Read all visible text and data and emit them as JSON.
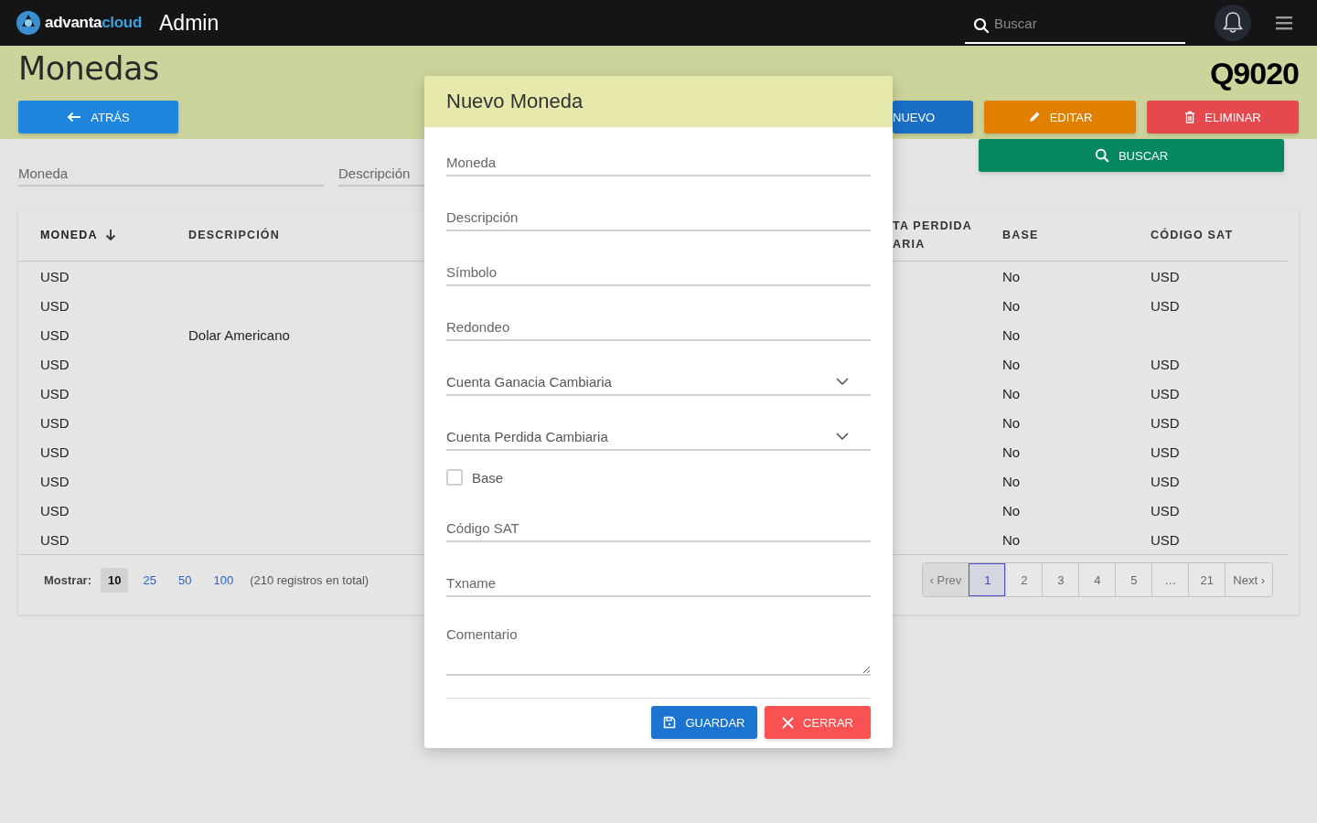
{
  "topbar": {
    "brand": {
      "part_1": "advanta",
      "part_2": "cloud"
    },
    "app_name": "Admin",
    "search": {
      "placeholder": "Buscar"
    }
  },
  "page": {
    "title": "Monedas",
    "code": "Q9020"
  },
  "actions": [
    {
      "label": "ATRÁS",
      "kind": "back"
    },
    {
      "label": "NUEVO",
      "kind": "new"
    },
    {
      "label": "EDITAR",
      "kind": "edit"
    },
    {
      "label": "ELIMINAR",
      "kind": "delete"
    }
  ],
  "search_button": {
    "label": "BUSCAR"
  },
  "filters": [
    {
      "placeholder": "Moneda"
    },
    {
      "placeholder": "Descripción"
    }
  ],
  "table": {
    "columns": [
      {
        "label": "MONEDA",
        "sorted": true
      },
      {
        "label": "DESCRIPCIÓN",
        "sorted": false
      },
      {
        "label": "TA PERDIDA ARIA",
        "sorted": false
      },
      {
        "label": "BASE",
        "sorted": false
      },
      {
        "label": "CÓDIGO SAT",
        "sorted": false
      }
    ],
    "rows": [
      {
        "moneda": "USD",
        "base": "No",
        "codigo_sat": "USD"
      },
      {
        "moneda": "USD",
        "base": "No",
        "codigo_sat": "USD"
      },
      {
        "moneda": "USD",
        "descripcion": "Dolar Americano",
        "base": "No"
      },
      {
        "moneda": "USD",
        "base": "No",
        "codigo_sat": "USD"
      },
      {
        "moneda": "USD",
        "base": "No",
        "codigo_sat": "USD"
      },
      {
        "moneda": "USD",
        "base": "No",
        "codigo_sat": "USD"
      },
      {
        "moneda": "USD",
        "base": "No",
        "codigo_sat": "USD"
      },
      {
        "moneda": "USD",
        "base": "No",
        "codigo_sat": "USD"
      },
      {
        "moneda": "USD",
        "base": "No",
        "codigo_sat": "USD"
      },
      {
        "moneda": "USD",
        "base": "No",
        "codigo_sat": "USD"
      }
    ]
  },
  "footer": {
    "show_label": "Mostrar:",
    "page_sizes": [
      {
        "label": "10",
        "selected": true
      },
      {
        "label": "25",
        "selected": false
      },
      {
        "label": "50",
        "selected": false
      },
      {
        "label": "100",
        "selected": false
      }
    ],
    "total": "(210 registros en total)"
  },
  "pagination": [
    {
      "label": "‹ Prev",
      "selected": false,
      "disabled": true
    },
    {
      "label": "1",
      "selected": true,
      "disabled": false
    },
    {
      "label": "2",
      "selected": false,
      "disabled": false
    },
    {
      "label": "3",
      "selected": false,
      "disabled": false
    },
    {
      "label": "4",
      "selected": false,
      "disabled": false
    },
    {
      "label": "5",
      "selected": false,
      "disabled": false
    },
    {
      "label": "…",
      "selected": false,
      "disabled": false
    },
    {
      "label": "21",
      "selected": false,
      "disabled": false
    },
    {
      "label": "Next ›",
      "selected": false,
      "disabled": false
    }
  ],
  "modal": {
    "title": "Nuevo Moneda",
    "fields": [
      {
        "placeholder": "Moneda",
        "kind": "text"
      },
      {
        "placeholder": "Descripción",
        "kind": "text"
      },
      {
        "placeholder": "Símbolo",
        "kind": "text"
      },
      {
        "placeholder": "Redondeo",
        "kind": "text"
      },
      {
        "label": "Cuenta Ganacia Cambiaria",
        "kind": "select"
      },
      {
        "label": "Cuenta Perdida Cambiaria",
        "kind": "select"
      },
      {
        "label": "Base",
        "kind": "checkbox",
        "checked": false
      },
      {
        "placeholder": "Código SAT",
        "kind": "text"
      },
      {
        "placeholder": "Txname",
        "kind": "text"
      },
      {
        "placeholder": "Comentario",
        "kind": "textarea"
      }
    ],
    "buttons": [
      {
        "label": "GUARDAR",
        "kind": "save"
      },
      {
        "label": "CERRAR",
        "kind": "close"
      }
    ]
  }
}
